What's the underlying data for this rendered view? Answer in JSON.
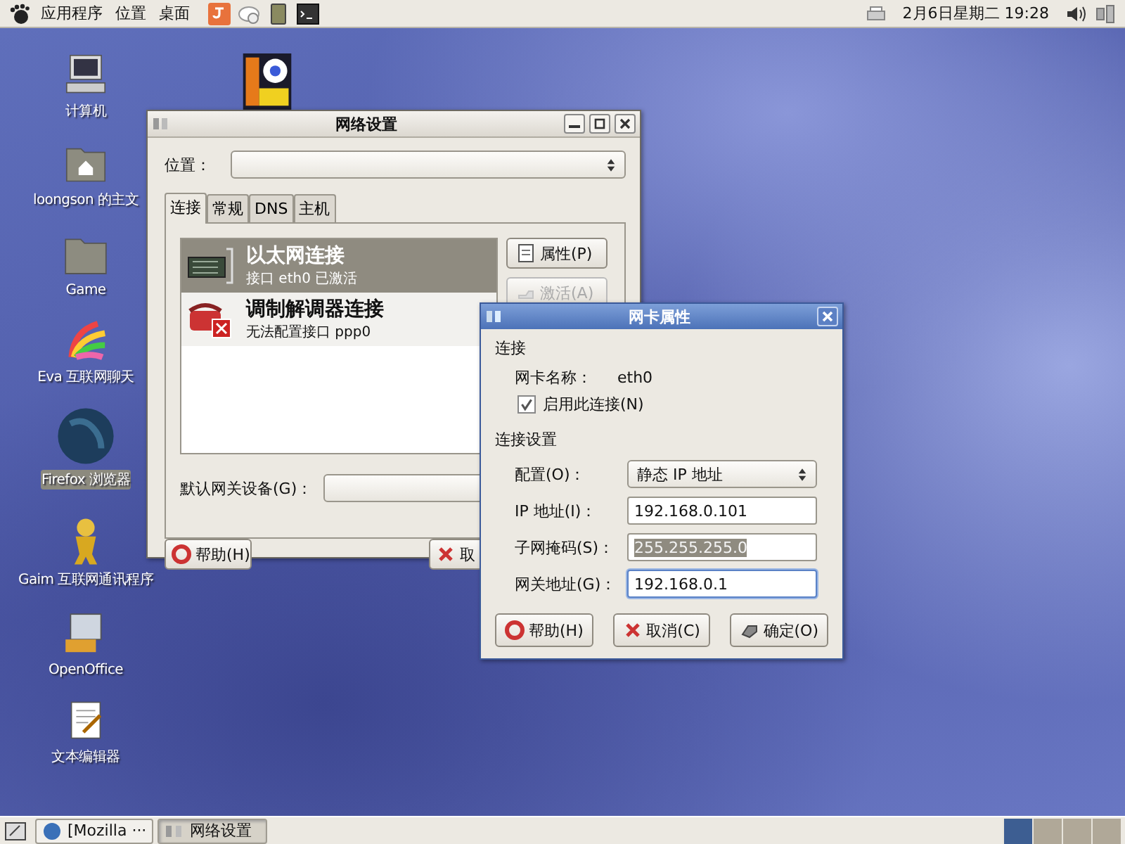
{
  "top_panel": {
    "menus": [
      "应用程序",
      "位置",
      "桌面"
    ],
    "clock": "2月6日星期二 19:28"
  },
  "desktop_icons": [
    {
      "kind": "computer",
      "label": "计算机",
      "selected": false
    },
    {
      "kind": "home",
      "label": "loongson 的主文",
      "selected": false
    },
    {
      "kind": "folder",
      "label": "Game",
      "selected": false
    },
    {
      "kind": "eva",
      "label": "Eva 互联网聊天",
      "selected": false
    },
    {
      "kind": "globe",
      "label": "Firefox 浏览器",
      "selected": true
    },
    {
      "kind": "gaim",
      "label": "Gaim 互联网通讯程序",
      "selected": false
    },
    {
      "kind": "office",
      "label": "OpenOffice",
      "selected": false
    },
    {
      "kind": "notepad",
      "label": "文本编辑器",
      "selected": false
    }
  ],
  "network_window": {
    "title": "网络设置",
    "location_label": "位置：",
    "tabs": [
      {
        "label": "连接",
        "selected": true
      },
      {
        "label": "常规",
        "selected": false
      },
      {
        "label": "DNS",
        "selected": false
      },
      {
        "label": "主机",
        "selected": false
      }
    ],
    "connections": [
      {
        "kind": "ethernet",
        "title": "以太网连接",
        "subtitle": "接口 eth0 已激活",
        "selected": true
      },
      {
        "kind": "modem",
        "title": "调制解调器连接",
        "subtitle": "无法配置接口 ppp0",
        "selected": false
      }
    ],
    "side_buttons": [
      {
        "kind": "properties",
        "label": "属性(P)",
        "disabled": false
      },
      {
        "kind": "activate",
        "label": "激活(A)",
        "disabled": true
      }
    ],
    "gateway_label": "默认网关设备(G)：",
    "buttons": [
      {
        "kind": "help",
        "label": "帮助(H)"
      },
      {
        "kind": "cancel",
        "label": "取"
      }
    ]
  },
  "nic_dialog": {
    "title": "网卡属性",
    "section_connection": "连接",
    "name_label": "网卡名称：",
    "name_value": "eth0",
    "enable": {
      "label": "启用此连接(N)",
      "checked": true
    },
    "section_settings": "连接设置",
    "config": {
      "label": "配置(O)：",
      "value": "静态 IP 地址"
    },
    "fields": [
      {
        "label": "IP 地址(I)：",
        "value": "192.168.0.101",
        "text_selected": false,
        "focused": false
      },
      {
        "label": "子网掩码(S)：",
        "value": "255.255.255.0",
        "text_selected": true,
        "focused": false
      },
      {
        "label": "网关地址(G)：",
        "value": "192.168.0.1",
        "text_selected": false,
        "focused": true
      }
    ],
    "buttons": [
      {
        "kind": "help",
        "label": "帮助(H)"
      },
      {
        "kind": "cancel",
        "label": "取消(C)"
      },
      {
        "kind": "ok",
        "label": "确定(O)"
      }
    ]
  },
  "taskbar": {
    "tasks": [
      {
        "kind": "globe",
        "label": "[Mozilla ···",
        "selected": false
      },
      {
        "kind": "network",
        "label": "网络设置",
        "selected": true
      }
    ],
    "workspaces": [
      {
        "selected": true
      },
      {
        "selected": false
      },
      {
        "selected": false
      },
      {
        "selected": false
      }
    ]
  }
}
